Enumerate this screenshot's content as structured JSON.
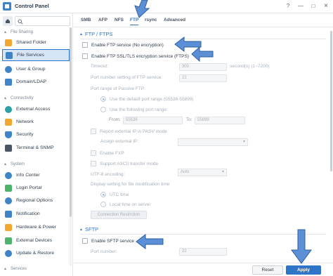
{
  "window": {
    "title": "Control Panel",
    "help_icon": "?",
    "minimize_icon": "—",
    "maximize_icon": "□",
    "close_icon": "×"
  },
  "sidebar": {
    "sections": [
      {
        "label": "File Sharing"
      },
      {
        "label": "Connectivity"
      },
      {
        "label": "System"
      },
      {
        "label": "Services"
      }
    ],
    "items": [
      {
        "label": "Shared Folder",
        "icon": "folder-icon",
        "color": "#f0a830"
      },
      {
        "label": "File Services",
        "icon": "file-services-icon",
        "color": "#3f83c9"
      },
      {
        "label": "User & Group",
        "icon": "user-group-icon",
        "color": "#3f83c9"
      },
      {
        "label": "Domain/LDAP",
        "icon": "domain-icon",
        "color": "#3f83c9"
      },
      {
        "label": "External Access",
        "icon": "external-access-icon",
        "color": "#2aa1a8"
      },
      {
        "label": "Network",
        "icon": "network-icon",
        "color": "#f0a830"
      },
      {
        "label": "Security",
        "icon": "shield-icon",
        "color": "#3f83c9"
      },
      {
        "label": "Terminal & SNMP",
        "icon": "terminal-icon",
        "color": "#4a5563"
      },
      {
        "label": "Info Center",
        "icon": "info-icon",
        "color": "#3f83c9"
      },
      {
        "label": "Login Portal",
        "icon": "login-portal-icon",
        "color": "#4db36a"
      },
      {
        "label": "Regional Options",
        "icon": "globe-icon",
        "color": "#3f83c9"
      },
      {
        "label": "Notification",
        "icon": "notification-icon",
        "color": "#3f83c9"
      },
      {
        "label": "Hardware & Power",
        "icon": "hardware-icon",
        "color": "#f0a830"
      },
      {
        "label": "External Devices",
        "icon": "external-devices-icon",
        "color": "#4db36a"
      },
      {
        "label": "Update & Restore",
        "icon": "update-icon",
        "color": "#3f83c9"
      }
    ]
  },
  "tabs": [
    "SMB",
    "AFP",
    "NFS",
    "FTP",
    "rsync",
    "Advanced"
  ],
  "ftp": {
    "section_title": "FTP / FTPS",
    "enable_ftp": "Enable FTP service (No encryption)",
    "enable_ftps": "Enable FTP SSL/TLS encryption service (FTPS)",
    "timeout_label": "Timeout:",
    "timeout_value": "300",
    "timeout_unit": "second(s) (1~7200)",
    "port_label": "Port number setting of FTP service:",
    "port_value": "21",
    "passive_label": "Port range of Passive FTP:",
    "passive_default": "Use the default port range (55536-55899)",
    "passive_custom": "Use the following port range:",
    "from_label": "From:",
    "from_value": "55536",
    "to_label": "To:",
    "to_value": "55899",
    "report_ip": "Report external IP in PASV mode",
    "assign_ip_label": "Assign external IP:",
    "enable_fxp": "Enable FXP",
    "ascii_mode": "Support ASCII transfer mode",
    "utf8_label": "UTF-8 encoding:",
    "utf8_value": "Auto",
    "time_display_label": "Display setting for file modification time",
    "utc_time": "UTC time",
    "local_time": "Local time on server",
    "conn_restriction": "Connection Restriction"
  },
  "sftp": {
    "section_title": "SFTP",
    "enable_sftp": "Enable SFTP service",
    "port_label": "Port number:",
    "port_value": "22"
  },
  "footer": {
    "reset": "Reset",
    "apply": "Apply"
  },
  "colors": {
    "accent": "#2f75c7",
    "arrow": "#5b8fd6"
  }
}
